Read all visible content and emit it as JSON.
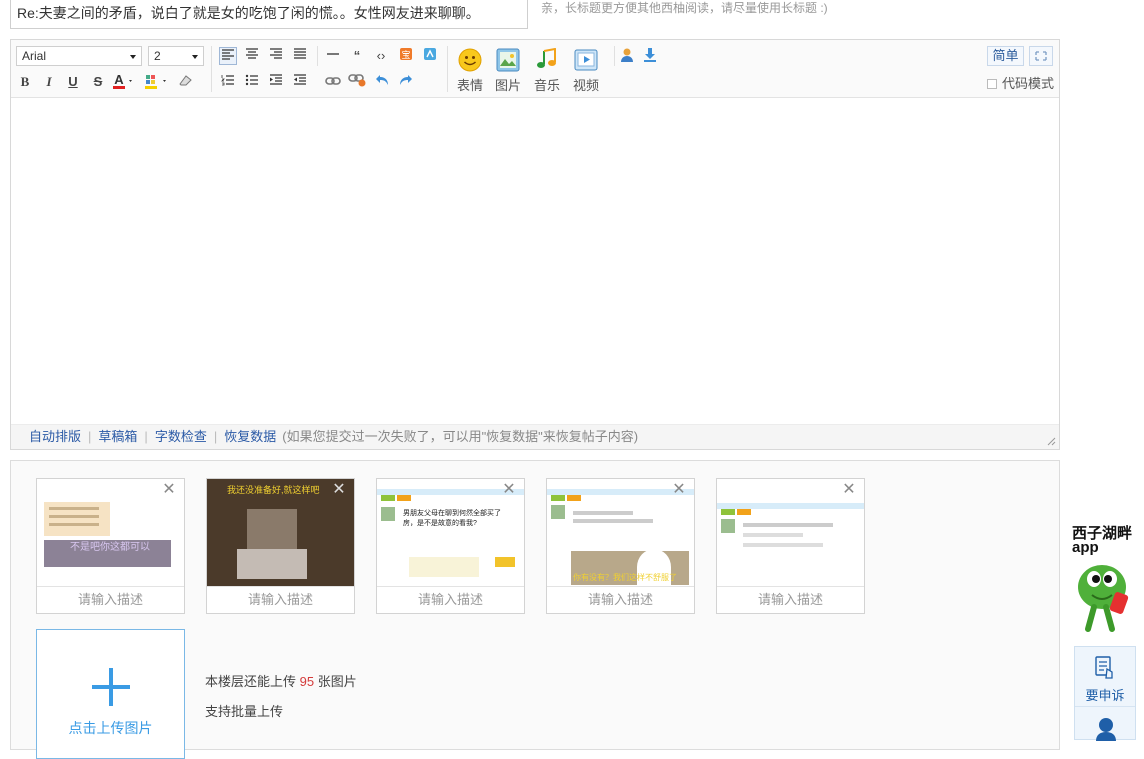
{
  "title": {
    "value": "Re:夫妻之间的矛盾，说白了就是女的吃饱了闲的慌。。女性网友进来聊聊。",
    "hint": "亲，长标题更方便其他西柚阅读，请尽量使用长标题 :)"
  },
  "toolbar": {
    "font_family": "Arial",
    "font_size": "2",
    "big_buttons": [
      "表情",
      "图片",
      "音乐",
      "视频"
    ],
    "simple_mode_label": "简单",
    "code_mode_label": "代码模式",
    "icons": {
      "row1": [
        "align-left-icon",
        "align-center-icon",
        "align-right-icon",
        "align-justify-icon",
        "horizontal-rule-icon",
        "quote-icon",
        "code-icon",
        "red-icon",
        "blue-icon"
      ],
      "row2": [
        "bold-icon",
        "italic-icon",
        "underline-icon",
        "strikethrough-icon",
        "font-color-icon",
        "bg-color-icon",
        "eraser-icon",
        "ordered-list-icon",
        "unordered-list-icon",
        "indent-icon",
        "outdent-icon",
        "link-icon",
        "unlink-icon",
        "undo-icon",
        "redo-icon"
      ]
    }
  },
  "status_bar": {
    "links": [
      "自动排版",
      "草稿箱",
      "字数检查",
      "恢复数据"
    ],
    "hint": "(如果您提交过一次失败了，可以用\"恢复数据\"来恢复帖子内容)"
  },
  "uploads": {
    "items": [
      {
        "desc_placeholder": "请输入描述",
        "overlay_text": "不是吧你这都可以"
      },
      {
        "desc_placeholder": "请输入描述",
        "overlay_text": "我还没准备好,就这样吧"
      },
      {
        "desc_placeholder": "请输入描述",
        "overlay_text": "男朋友父母在聊到何然全部买了房，是不是故意的看我?"
      },
      {
        "desc_placeholder": "请输入描述",
        "overlay_text": "你有没有？我们这样不舒服了"
      },
      {
        "desc_placeholder": "请输入描述",
        "overlay_text": ""
      }
    ],
    "add_label": "点击上传图片",
    "remaining_prefix": "本楼层还能上传",
    "remaining_count": "95",
    "remaining_suffix": "张图片",
    "batch_label": "支持批量上传"
  },
  "side": {
    "app_logo_line1": "西子湖畔",
    "app_logo_line2": "app",
    "appeal_label": "要申诉"
  },
  "colors": {
    "accent": "#3a9be4",
    "link": "#2b5aa6",
    "count": "#d43b3b"
  }
}
